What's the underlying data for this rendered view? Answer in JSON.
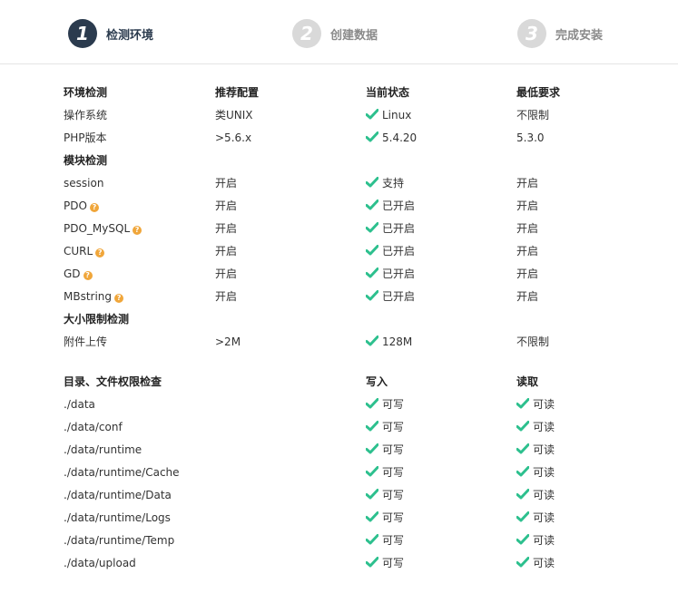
{
  "colors": {
    "accent": "#2b3b4e",
    "inactive": "#d9d9d9",
    "ok": "#2dc08e",
    "help": "#f0a63a"
  },
  "steps": [
    {
      "num": "1",
      "label": "检测环境",
      "active": true
    },
    {
      "num": "2",
      "label": "创建数据",
      "active": false
    },
    {
      "num": "3",
      "label": "完成安装",
      "active": false
    }
  ],
  "env": {
    "headers": [
      "环境检测",
      "推荐配置",
      "当前状态",
      "最低要求"
    ],
    "rows": [
      {
        "name": "操作系统",
        "recommended": "类UNIX",
        "current": "Linux",
        "minimum": "不限制"
      },
      {
        "name": "PHP版本",
        "recommended": ">5.6.x",
        "current": "5.4.20",
        "minimum": "5.3.0"
      }
    ]
  },
  "modules": {
    "heading": "模块检测",
    "rows": [
      {
        "name": "session",
        "help": false,
        "recommended": "开启",
        "current": "支持",
        "minimum": "开启"
      },
      {
        "name": "PDO",
        "help": true,
        "recommended": "开启",
        "current": "已开启",
        "minimum": "开启"
      },
      {
        "name": "PDO_MySQL",
        "help": true,
        "recommended": "开启",
        "current": "已开启",
        "minimum": "开启"
      },
      {
        "name": "CURL",
        "help": true,
        "recommended": "开启",
        "current": "已开启",
        "minimum": "开启"
      },
      {
        "name": "GD",
        "help": true,
        "recommended": "开启",
        "current": "已开启",
        "minimum": "开启"
      },
      {
        "name": "MBstring",
        "help": true,
        "recommended": "开启",
        "current": "已开启",
        "minimum": "开启"
      }
    ]
  },
  "limits": {
    "heading": "大小限制检测",
    "rows": [
      {
        "name": "附件上传",
        "recommended": ">2M",
        "current": "128M",
        "minimum": "不限制"
      }
    ]
  },
  "dirs": {
    "headers": [
      "目录、文件权限检查",
      "写入",
      "读取"
    ],
    "rows": [
      {
        "path": "./data",
        "write": "可写",
        "read": "可读"
      },
      {
        "path": "./data/conf",
        "write": "可写",
        "read": "可读"
      },
      {
        "path": "./data/runtime",
        "write": "可写",
        "read": "可读"
      },
      {
        "path": "./data/runtime/Cache",
        "write": "可写",
        "read": "可读"
      },
      {
        "path": "./data/runtime/Data",
        "write": "可写",
        "read": "可读"
      },
      {
        "path": "./data/runtime/Logs",
        "write": "可写",
        "read": "可读"
      },
      {
        "path": "./data/runtime/Temp",
        "write": "可写",
        "read": "可读"
      },
      {
        "path": "./data/upload",
        "write": "可写",
        "read": "可读"
      }
    ]
  }
}
